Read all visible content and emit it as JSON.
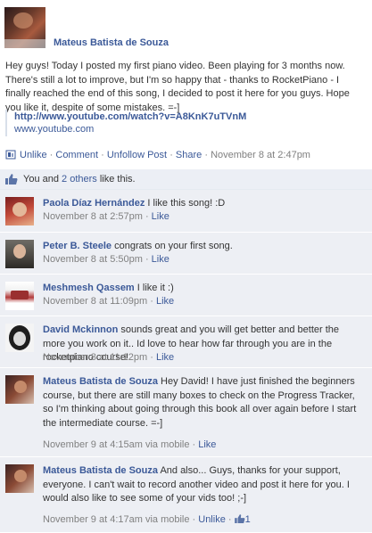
{
  "post": {
    "author": "Mateus Batista de Souza",
    "body": "Hey guys! Today I posted my first piano video. Been playing for 3 months now. There's still a lot to improve, but I'm so happy that - thanks to RocketPiano - I finally reached the end of this song, I decided to post it here for you guys. Hope you like it, despite of some mistakes. =-]",
    "link_url": "http://www.youtube.com/watch?v=A8KnK7uTVnM",
    "link_domain": "www.youtube.com",
    "actions": {
      "unlike": "Unlike",
      "comment": "Comment",
      "unfollow": "Unfollow Post",
      "share": "Share",
      "timestamp": "November 8 at 2:47pm",
      "sep": "·"
    }
  },
  "likes": {
    "prefix": "You and",
    "others": "2 others",
    "suffix": "like this."
  },
  "comments": [
    {
      "name": "Paola Díaz Hernández",
      "text": "I like this song! :D",
      "time": "November 8 at 2:57pm",
      "actions": [
        "Like"
      ]
    },
    {
      "name": "Peter B. Steele",
      "text": "congrats on your first song.",
      "time": "November 8 at 5:50pm",
      "actions": [
        "Like"
      ]
    },
    {
      "name": "Meshmesh Qassem",
      "text": "I like it :)",
      "time": "November 8 at 11:09pm",
      "actions": [
        "Like"
      ]
    },
    {
      "name": "David Mckinnon",
      "text": "sounds great and you will get better and better the more you work on it.. Id love to hear how far through you are in the rocketpiano course!",
      "time": "November 8 at 11:12pm",
      "actions": [
        "Like"
      ]
    },
    {
      "name": "Mateus Batista de Souza",
      "text": "Hey David! I have just finished the beginners course, but there are still many boxes to check on the Progress Tracker, so I'm thinking about going through this book all over again before I start the intermediate course. =-]",
      "time": "November 9 at 4:15am via mobile",
      "actions": [
        "Like"
      ]
    },
    {
      "name": "Mateus Batista de Souza",
      "text": "And also... Guys, thanks for your support, everyone. I can't wait to record another video and post it here for you. I would also like to see some of your vids too! ;-]",
      "time": "November 9 at 4:17am via mobile",
      "actions": [
        "Unlike"
      ],
      "like_count": "1"
    }
  ],
  "icons": {
    "thumbs_up": "thumbs-up-icon",
    "unlike": "unlike-icon"
  },
  "colors": {
    "link": "#3b5998",
    "comment_bg": "#edeff4",
    "likes_bg": "#eceff5",
    "meta": "#808080"
  }
}
